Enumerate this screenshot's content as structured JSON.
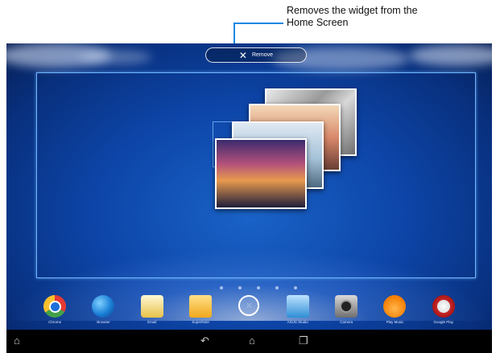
{
  "callout": {
    "line1": "Removes the widget from the",
    "line2": "Home Screen",
    "accent": "#1e88e5"
  },
  "remove_bar": {
    "label": "Remove",
    "icon": "close-icon"
  },
  "widget": {
    "frame_color": "#6fb6ff",
    "photos": [
      "photo-1",
      "photo-2",
      "photo-3",
      "photo-4"
    ]
  },
  "page_indicator": {
    "count": 5
  },
  "dock": {
    "apps": [
      {
        "label": "Chrome",
        "icon": "chrome-icon"
      },
      {
        "label": "Browser",
        "icon": "globe-icon"
      },
      {
        "label": "Email",
        "icon": "email-icon"
      },
      {
        "label": "SuperNote",
        "icon": "notebook-icon"
      },
      {
        "label": "",
        "icon": "all-apps-icon"
      },
      {
        "label": "ASUS Studio",
        "icon": "gallery-icon"
      },
      {
        "label": "Camera",
        "icon": "camera-icon"
      },
      {
        "label": "Play Music",
        "icon": "headphones-icon"
      },
      {
        "label": "Google Play",
        "icon": "play-store-icon"
      }
    ]
  },
  "navbar": {
    "icons": [
      "home-up-icon",
      "back-icon",
      "home-icon",
      "recent-apps-icon"
    ]
  }
}
